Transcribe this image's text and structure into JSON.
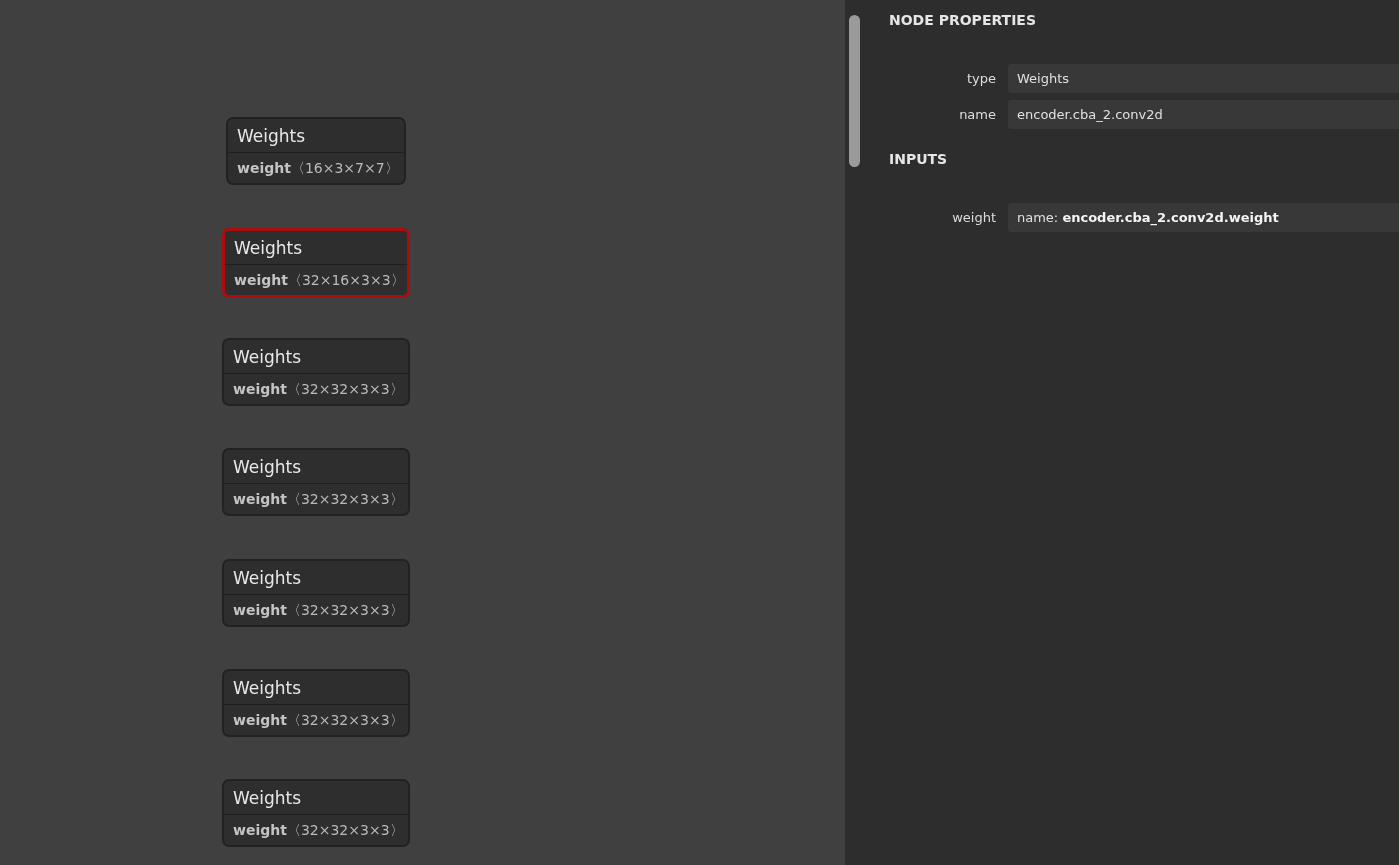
{
  "graph": {
    "nodes": [
      {
        "title": "Weights",
        "attribute": "weight",
        "shape": "〈16×3×7×7〉",
        "selected": false
      },
      {
        "title": "Weights",
        "attribute": "weight",
        "shape": "〈32×16×3×3〉",
        "selected": true
      },
      {
        "title": "Weights",
        "attribute": "weight",
        "shape": "〈32×32×3×3〉",
        "selected": false
      },
      {
        "title": "Weights",
        "attribute": "weight",
        "shape": "〈32×32×3×3〉",
        "selected": false
      },
      {
        "title": "Weights",
        "attribute": "weight",
        "shape": "〈32×32×3×3〉",
        "selected": false
      },
      {
        "title": "Weights",
        "attribute": "weight",
        "shape": "〈32×32×3×3〉",
        "selected": false
      },
      {
        "title": "Weights",
        "attribute": "weight",
        "shape": "〈32×32×3×3〉",
        "selected": false
      }
    ]
  },
  "sidebar": {
    "sections": [
      {
        "title": "NODE PROPERTIES",
        "rows": [
          {
            "label": "type",
            "value": "Weights"
          },
          {
            "label": "name",
            "value": "encoder.cba_2.conv2d"
          }
        ]
      },
      {
        "title": "INPUTS",
        "rows": [
          {
            "label": "weight",
            "value": "name: **encoder.cba_2.conv2d.weight**"
          }
        ]
      }
    ]
  }
}
